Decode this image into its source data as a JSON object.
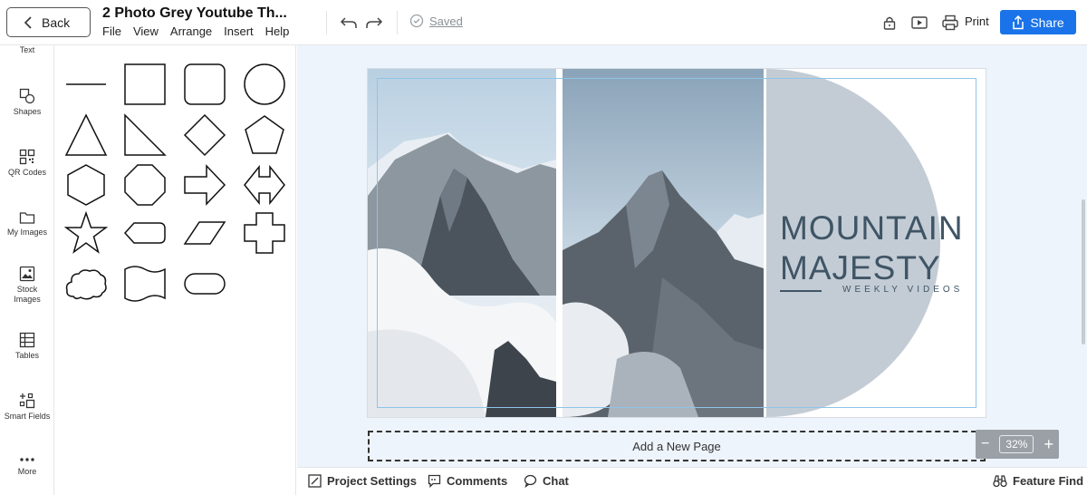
{
  "header": {
    "back_label": "Back",
    "title": "2 Photo Grey Youtube Th...",
    "menu": [
      "File",
      "View",
      "Arrange",
      "Insert",
      "Help"
    ],
    "saved_label": "Saved",
    "print_label": "Print",
    "share_label": "Share"
  },
  "rail": {
    "items": [
      {
        "label": "Text",
        "icon": "text-icon"
      },
      {
        "label": "Shapes",
        "icon": "shapes-icon"
      },
      {
        "label": "QR Codes",
        "icon": "qr-code-icon"
      },
      {
        "label": "My Images",
        "icon": "folder-icon"
      },
      {
        "label": "Stock Images",
        "icon": "image-icon"
      },
      {
        "label": "Tables",
        "icon": "table-icon"
      },
      {
        "label": "Smart Fields",
        "icon": "smart-fields-icon"
      },
      {
        "label": "More",
        "icon": "more-icon"
      }
    ]
  },
  "shapes_panel": {
    "shapes": [
      "line",
      "square",
      "rounded-square",
      "circle",
      "triangle",
      "right-triangle",
      "diamond",
      "pentagon",
      "hexagon",
      "octagon",
      "arrow",
      "double-arrow",
      "star",
      "tag",
      "parallelogram",
      "cross",
      "cloud",
      "wave",
      "pill"
    ]
  },
  "canvas": {
    "title_line1": "MOUNTAIN",
    "title_line2": "MAJESTY",
    "subtitle": "WEEKLY VIDEOS",
    "add_page_label": "Add a New Page",
    "zoom_value": "32%",
    "colors": {
      "text": "#3f5566",
      "half_circle": "#c3ccd5",
      "workspace": "#eef4fb",
      "accent": "#1a73e8"
    }
  },
  "footer": {
    "project_settings": "Project Settings",
    "comments": "Comments",
    "chat": "Chat",
    "feature_find": "Feature Find"
  }
}
